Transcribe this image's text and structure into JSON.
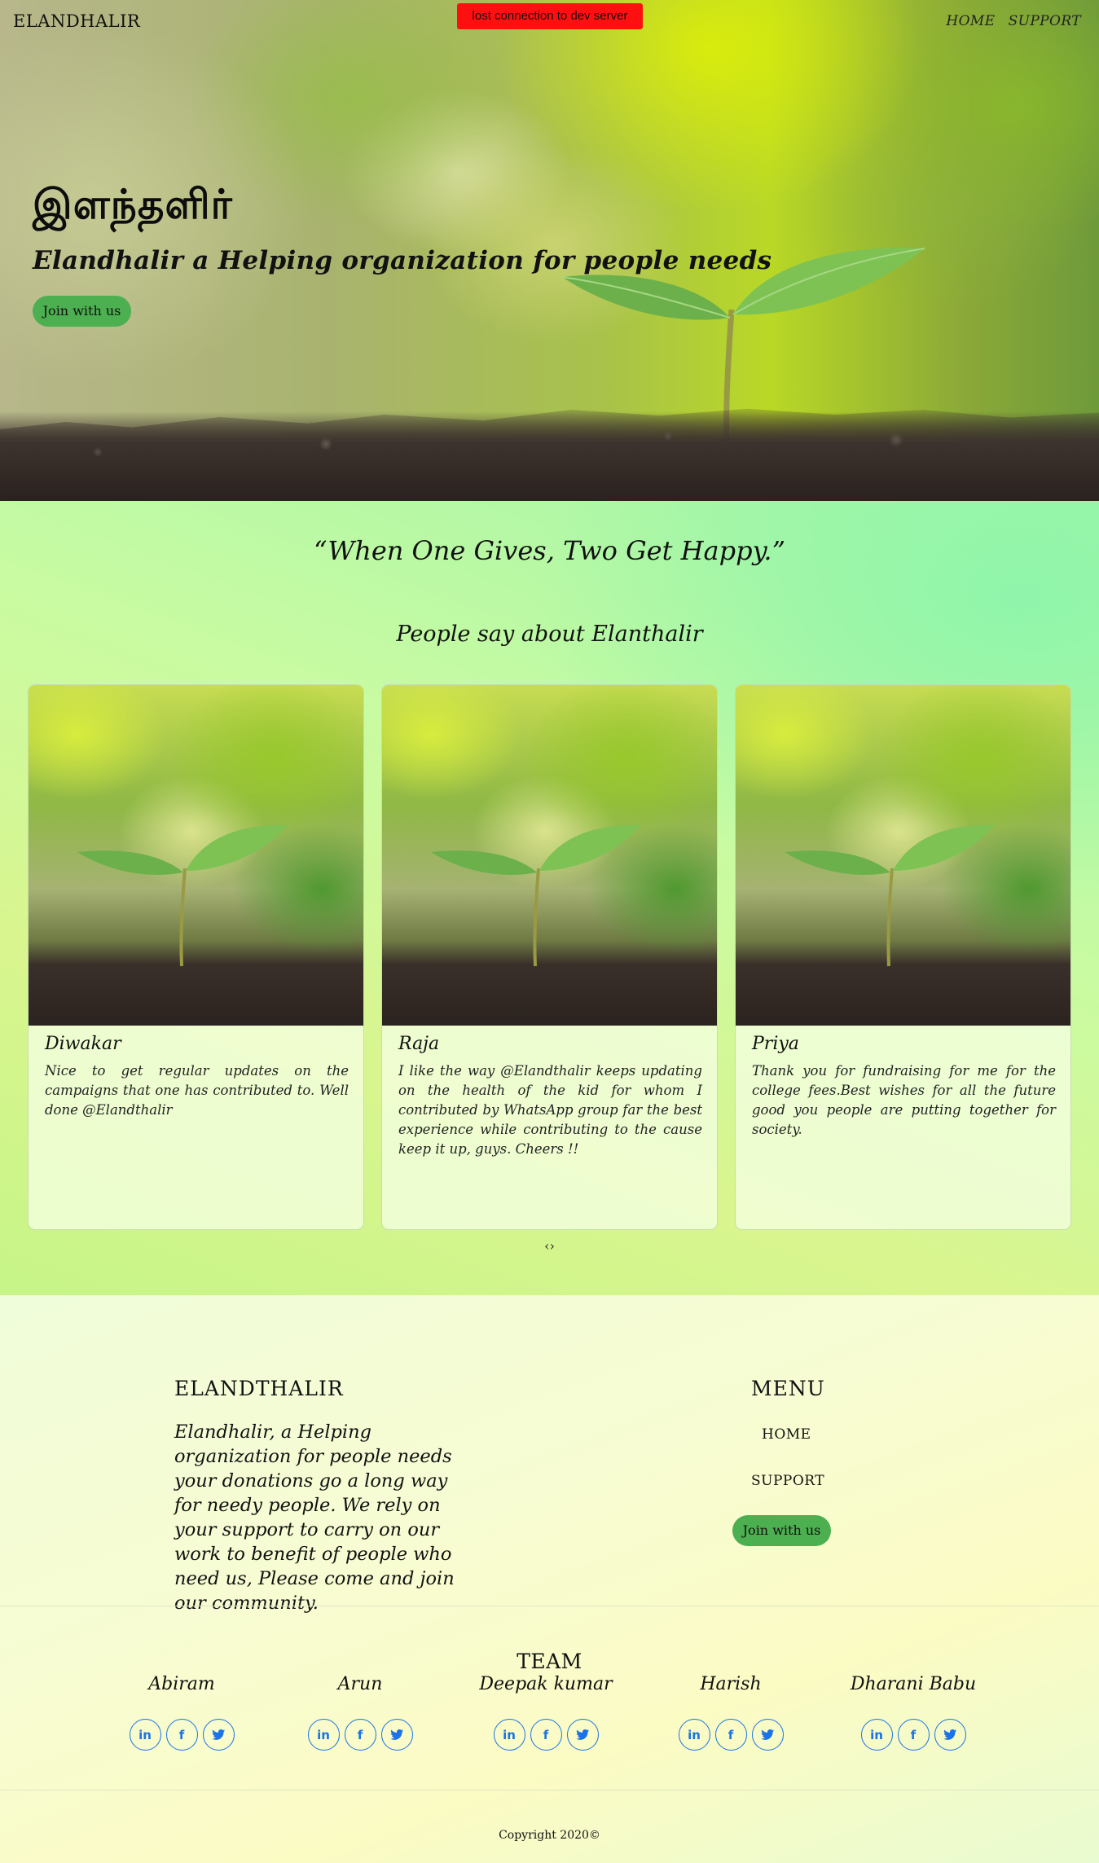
{
  "nav": {
    "logo": "ELANDHALIR",
    "links": [
      "HOME",
      "SUPPORT"
    ]
  },
  "dev_banner": "lost connection to dev server",
  "hero": {
    "tamil_title": "இளந்தளிர்",
    "tagline": "Elandhalir a Helping organization for people needs",
    "cta": "Join with us"
  },
  "testimonials": {
    "quote": "“When One Gives, Two Get Happy.”",
    "heading": "People say about Elanthalir",
    "cards": [
      {
        "name": "Diwakar",
        "text": "Nice to get regular updates on the campaigns that one has contributed to. Well done @Elandthalir"
      },
      {
        "name": "Raja",
        "text": "I like the way @Elandthalir keeps updating on the health of the kid for whom I contributed by WhatsApp group far the best experience while contributing to the cause keep it up, guys. Cheers !!"
      },
      {
        "name": "Priya",
        "text": "Thank you for fundraising for me for the college fees.Best wishes for all the future good you people are putting together for society."
      }
    ],
    "carousel_controls": "‹›"
  },
  "footer": {
    "brand": "ELANDTHALIR",
    "description": "Elandhalir, a Helping organization for people needs your donations go a long way for needy people. We rely on your support to carry on our work to benefit of people who need us, Please come and join our community.",
    "menu_title": "MENU",
    "menu_links": [
      "HOME",
      "SUPPORT"
    ],
    "menu_cta": "Join with us",
    "team_title": "TEAM",
    "team": [
      {
        "name": "Abiram"
      },
      {
        "name": "Arun"
      },
      {
        "name": "Deepak kumar"
      },
      {
        "name": "Harish"
      },
      {
        "name": "Dharani Babu"
      }
    ],
    "social_icons": [
      "linkedin-icon",
      "facebook-icon",
      "twitter-icon"
    ],
    "copyright": "Copyright 2020©"
  },
  "colors": {
    "accent_green": "#4caf50",
    "social_blue": "#1a73e8",
    "dev_banner_red": "#ff1010"
  }
}
